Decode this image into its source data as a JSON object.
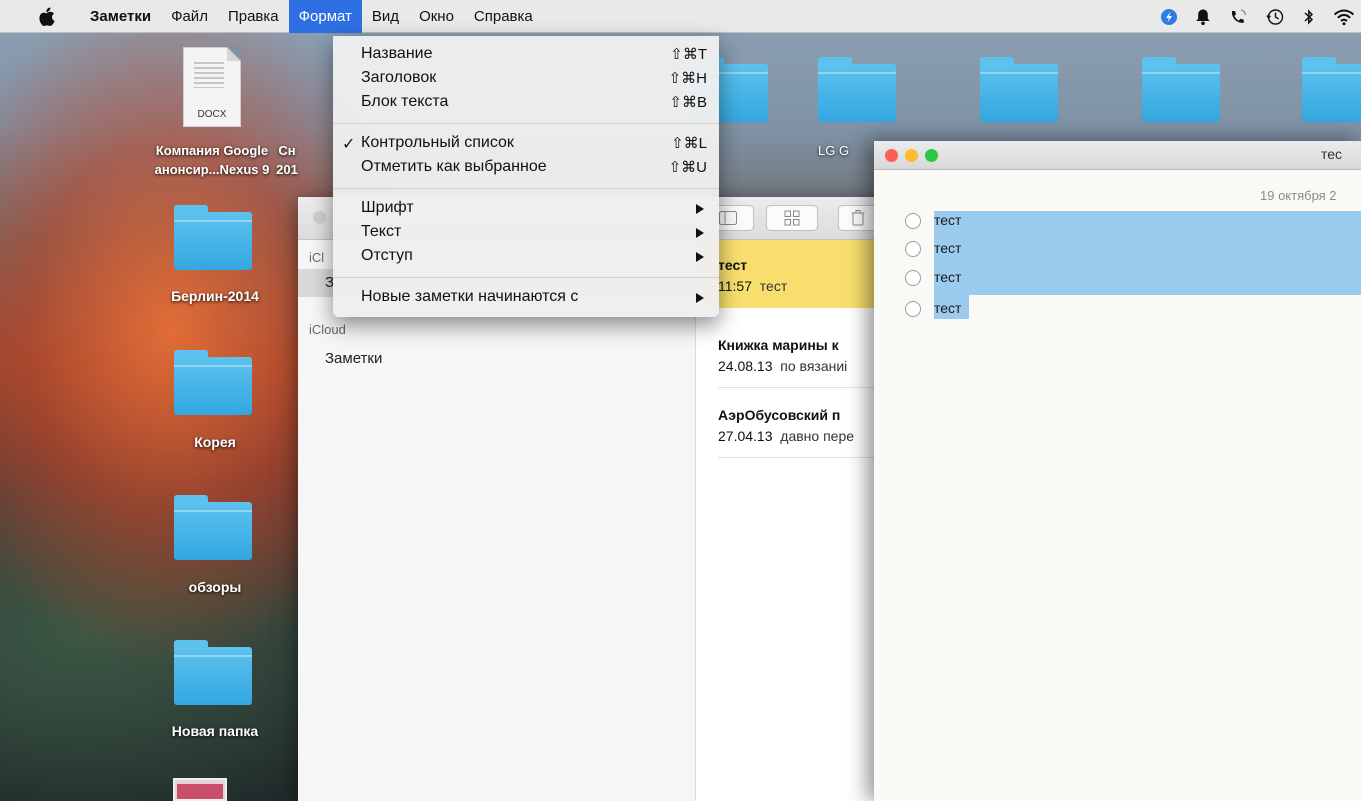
{
  "menubar": {
    "items": [
      {
        "label": "Заметки",
        "bold": true
      },
      {
        "label": "Файл"
      },
      {
        "label": "Правка"
      },
      {
        "label": "Формат",
        "active": true
      },
      {
        "label": "Вид"
      },
      {
        "label": "Окно"
      },
      {
        "label": "Справка"
      }
    ],
    "status_icons": [
      "app-status-icon",
      "notifications-bell-icon",
      "phone-icon",
      "time-machine-icon",
      "bluetooth-icon",
      "wifi-icon"
    ]
  },
  "desktop": {
    "file": {
      "ext": "DOCX",
      "label_line1": "Компания Google",
      "label_line2": "анонсир...Nexus 9"
    },
    "partial_label_line1": "Сн",
    "partial_label_line2": "201",
    "folders_left": [
      "Берлин-2014",
      "Корея",
      "обзоры",
      "Новая папка"
    ],
    "top_folder_label": "LG G"
  },
  "format_menu": {
    "groups": [
      [
        {
          "label": "Название",
          "shortcut": "⇧⌘T"
        },
        {
          "label": "Заголовок",
          "shortcut": "⇧⌘H"
        },
        {
          "label": "Блок текста",
          "shortcut": "⇧⌘B"
        }
      ],
      [
        {
          "label": "Контрольный список",
          "shortcut": "⇧⌘L",
          "checked": true
        },
        {
          "label": "Отметить как выбранное",
          "shortcut": "⇧⌘U"
        }
      ],
      [
        {
          "label": "Шрифт",
          "submenu": true
        },
        {
          "label": "Текст",
          "submenu": true
        },
        {
          "label": "Отступ",
          "submenu": true
        }
      ],
      [
        {
          "label": "Новые заметки начинаются с",
          "submenu": true
        }
      ]
    ],
    "check_mark": "✓"
  },
  "notes_window": {
    "sidebar": {
      "section1": "iCl",
      "section1_item": "З",
      "section2": "iCloud",
      "section2_item": "Заметки"
    },
    "notes": [
      {
        "title": "тест",
        "date": "11:57",
        "preview": "тест",
        "selected": true
      },
      {
        "title": "Книжка марины к",
        "date": "24.08.13",
        "preview": "по вязаниі"
      },
      {
        "title": "АэрОбусовский п",
        "date": "27.04.13",
        "preview": "давно пере"
      }
    ]
  },
  "note_window": {
    "title": "тес",
    "date": "19 октября 2",
    "checklist": [
      "тест",
      "тест",
      "тест",
      "тест"
    ]
  },
  "colors": {
    "menu_active": "#2f6fe4",
    "selected_note": "#f8df6d",
    "text_highlight": "#9ccbf0",
    "folder": "#45b3e8"
  }
}
